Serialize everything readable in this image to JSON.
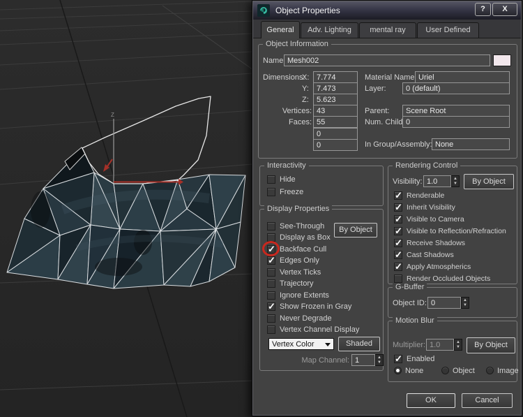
{
  "viewport": {
    "z_axis_label": "Z"
  },
  "colors": {
    "annotation_red": "#c8281e",
    "name_swatch_pink": "#f2e7ec",
    "mesh_teal": "#2a3b43",
    "dialog_bg": "#424242",
    "wireframe_white": "#dcdfe1"
  },
  "dialog": {
    "title": "Object Properties",
    "help_button": "?",
    "close_button": "X",
    "tabs": [
      {
        "label": "General",
        "active": true
      },
      {
        "label": "Adv. Lighting",
        "active": false
      },
      {
        "label": "mental ray",
        "active": false
      },
      {
        "label": "User Defined",
        "active": false
      }
    ],
    "object_information": {
      "legend": "Object Information",
      "name_label": "Name:",
      "name_value": "Mesh002",
      "dimensions_label": "Dimensions:",
      "dim_x_label": "X:",
      "dim_x": "7.774",
      "dim_y_label": "Y:",
      "dim_y": "7.473",
      "dim_z_label": "Z:",
      "dim_z": "5.623",
      "vertices_label": "Vertices:",
      "vertices": "43",
      "faces_label": "Faces:",
      "faces": "55",
      "extra_field_1": "0",
      "extra_field_2": "0",
      "material_label": "Material Name:",
      "material": "Uriel",
      "layer_label": "Layer:",
      "layer": "0 (default)",
      "parent_label": "Parent:",
      "parent": "Scene Root",
      "num_children_label": "Num. Children:",
      "num_children": "0",
      "in_group_label": "In Group/Assembly:",
      "in_group": "None"
    },
    "interactivity": {
      "legend": "Interactivity",
      "items": [
        {
          "label": "Hide",
          "checked": false
        },
        {
          "label": "Freeze",
          "checked": false
        }
      ]
    },
    "display_properties": {
      "legend": "Display Properties",
      "by_object": "By Object",
      "items": [
        {
          "label": "See-Through",
          "checked": false
        },
        {
          "label": "Display as Box",
          "checked": false
        },
        {
          "label": "Backface Cull",
          "checked": true
        },
        {
          "label": "Edges Only",
          "checked": true
        },
        {
          "label": "Vertex Ticks",
          "checked": false
        },
        {
          "label": "Trajectory",
          "checked": false
        },
        {
          "label": "Ignore Extents",
          "checked": false
        },
        {
          "label": "Show Frozen in Gray",
          "checked": true
        },
        {
          "label": "Never Degrade",
          "checked": false
        },
        {
          "label": "Vertex Channel Display",
          "checked": false
        }
      ],
      "vertex_channel_value": "Vertex Color",
      "shaded_button": "Shaded",
      "map_channel_label": "Map Channel:",
      "map_channel": "1"
    },
    "rendering_control": {
      "legend": "Rendering Control",
      "visibility_label": "Visibility:",
      "visibility": "1.0",
      "by_object": "By Object",
      "items": [
        {
          "label": "Renderable",
          "checked": true
        },
        {
          "label": "Inherit Visibility",
          "checked": true
        },
        {
          "label": "Visible to Camera",
          "checked": true
        },
        {
          "label": "Visible to Reflection/Refraction",
          "checked": true
        },
        {
          "label": "Receive Shadows",
          "checked": true
        },
        {
          "label": "Cast Shadows",
          "checked": true
        },
        {
          "label": "Apply Atmospherics",
          "checked": true
        },
        {
          "label": "Render Occluded Objects",
          "checked": false
        }
      ]
    },
    "g_buffer": {
      "legend": "G-Buffer",
      "object_id_label": "Object ID:",
      "object_id": "0"
    },
    "motion_blur": {
      "legend": "Motion Blur",
      "multiplier_label": "Multiplier:",
      "multiplier": "1.0",
      "by_object": "By Object",
      "enabled_label": "Enabled",
      "enabled": true,
      "options": [
        {
          "label": "None",
          "selected": true
        },
        {
          "label": "Object",
          "selected": false
        },
        {
          "label": "Image",
          "selected": false
        }
      ]
    },
    "ok": "OK",
    "cancel": "Cancel"
  }
}
